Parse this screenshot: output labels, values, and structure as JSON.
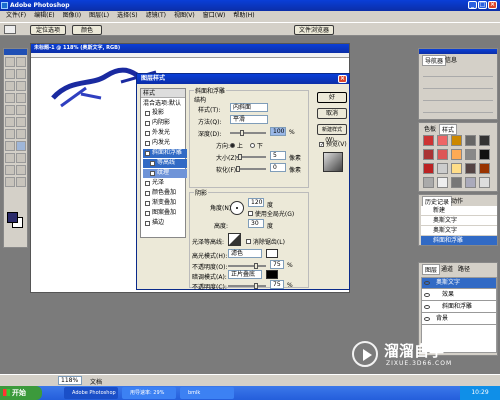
{
  "app": {
    "title": "Adobe Photoshop",
    "menus": [
      "文件(F)",
      "编辑(E)",
      "图像(I)",
      "图层(L)",
      "选择(S)",
      "滤镜(T)",
      "视图(V)",
      "窗口(W)",
      "帮助(H)"
    ],
    "options_bar": {
      "btn_a": "定位选项",
      "btn_b": "颜色",
      "palette_well": "文件浏览器"
    }
  },
  "document": {
    "title": "未标题-1 @ 118% (奥斯文字, RGB)",
    "zoom": "118%"
  },
  "dialog": {
    "title": "图层样式",
    "styles_header": "样式",
    "blend_options": "混合选项:默认",
    "style_items": [
      "投影",
      "内阴影",
      "外发光",
      "内发光",
      "斜面和浮雕",
      "等高线",
      "纹理",
      "光泽",
      "颜色叠加",
      "渐变叠加",
      "图案叠加",
      "描边"
    ],
    "section_title": "斜面和浮雕",
    "structure_label": "结构",
    "style_label": "样式(T):",
    "style_value": "内斜面",
    "technique_label": "方法(Q):",
    "technique_value": "平滑",
    "depth_label": "深度(D):",
    "depth_value": "100",
    "direction_label": "方向:",
    "direction_up": "上",
    "direction_down": "下",
    "size_label": "大小(Z):",
    "size_value": "5",
    "soften_label": "软化(F):",
    "soften_value": "0",
    "unit_px": "像素",
    "unit_pct": "%",
    "shading_label": "阴影",
    "angle_label": "角度(N):",
    "angle_value": "120",
    "unit_deg": "度",
    "global_light": "使用全局光(G)",
    "altitude_label": "高度:",
    "altitude_value": "30",
    "gloss_label": "光泽等高线:",
    "antialias": "消除锯齿(L)",
    "highlight_label": "高光模式(H):",
    "highlight_value": "滤色",
    "highlight_opacity_label": "不透明度(O):",
    "highlight_opacity": "75",
    "shadow_label": "暗调模式(A):",
    "shadow_value": "正片叠底",
    "shadow_opacity_label": "不透明度(C):",
    "shadow_opacity": "75",
    "ok": "好",
    "cancel": "取消",
    "new_style": "新建样式(W)...",
    "preview": "预览(V)"
  },
  "panels": {
    "navigator_tabs": [
      "导航器",
      "信息"
    ],
    "styles_tabs": [
      "色板",
      "样式"
    ],
    "history_tabs": [
      "历史记录",
      "动作"
    ],
    "history_items": [
      "新建",
      "奥斯文字",
      "奥斯文字",
      "斜面和浮雕"
    ],
    "layers_tabs": [
      "图层",
      "通道",
      "路径"
    ],
    "layers": [
      {
        "name": "奥斯文字"
      },
      {
        "name": "效果"
      },
      {
        "name": "斜面和浮雕"
      },
      {
        "name": "背景"
      }
    ]
  },
  "statusbar": {
    "zoom": "118%",
    "doc": "文档"
  },
  "taskbar": {
    "start": "开始",
    "tasks": [
      "Adobe Photoshop",
      "用导速率: 29%",
      "bmlk"
    ],
    "clock": "10:29"
  },
  "watermark": {
    "brand": "溜溜自学",
    "url": "ZIXUE.3D66.COM"
  },
  "colors": {
    "titlebar": "#0b3bd1",
    "dialog_bg": "#ece9d8",
    "selected": "#316ac5",
    "canvas_text": "#2233aa"
  }
}
